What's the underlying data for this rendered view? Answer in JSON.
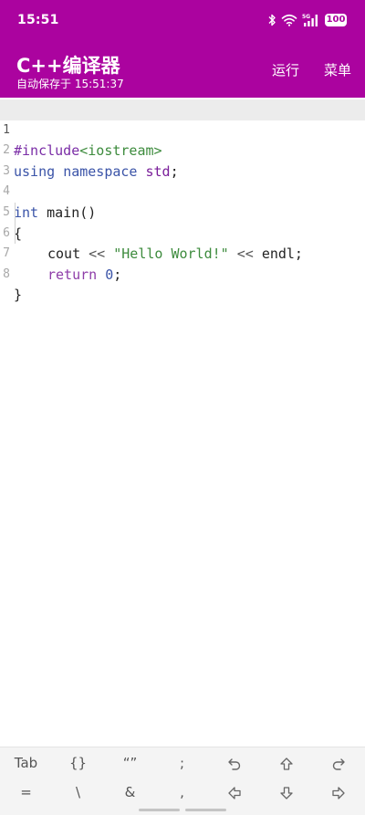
{
  "status_bar": {
    "time": "15:51",
    "network_label": "5G",
    "battery": "100"
  },
  "app_bar": {
    "title": "C++编译器",
    "autosave": "自动保存于 15:51:37",
    "run_label": "运行",
    "menu_label": "菜单",
    "accent_color": "#ab039f"
  },
  "editor": {
    "line_numbers": [
      "1",
      "2",
      "3",
      "4",
      "5",
      "6",
      "7",
      "8"
    ],
    "code": {
      "l1_directive": "#include",
      "l1_header": "<iostream>",
      "l2_using": "using",
      "l2_namespace": "namespace",
      "l2_std": "std",
      "l2_semi": ";",
      "l4_type": "int",
      "l4_rest": " main()",
      "l5_brace": "{",
      "l6_cout": "cout",
      "l6_op1": "<<",
      "l6_string": "\"Hello World!\"",
      "l6_op2": "<<",
      "l6_endl": "endl;",
      "l7_return": "return",
      "l7_value": "0",
      "l7_semi": ";",
      "l8_brace": "}"
    }
  },
  "keyboard": {
    "row1": [
      "Tab",
      "{}",
      "“”",
      ";",
      "undo-icon",
      "shift-up-icon",
      "redo-icon"
    ],
    "row2": [
      "=",
      "\\",
      "&",
      ",",
      "arrow-left-icon",
      "arrow-down-icon",
      "arrow-right-icon"
    ],
    "labels": {
      "tab": "Tab",
      "braces": "{}",
      "quotes": "“”",
      "semicolon": ";",
      "equals": "=",
      "backslash": "\\",
      "ampersand": "&",
      "comma": ","
    }
  }
}
